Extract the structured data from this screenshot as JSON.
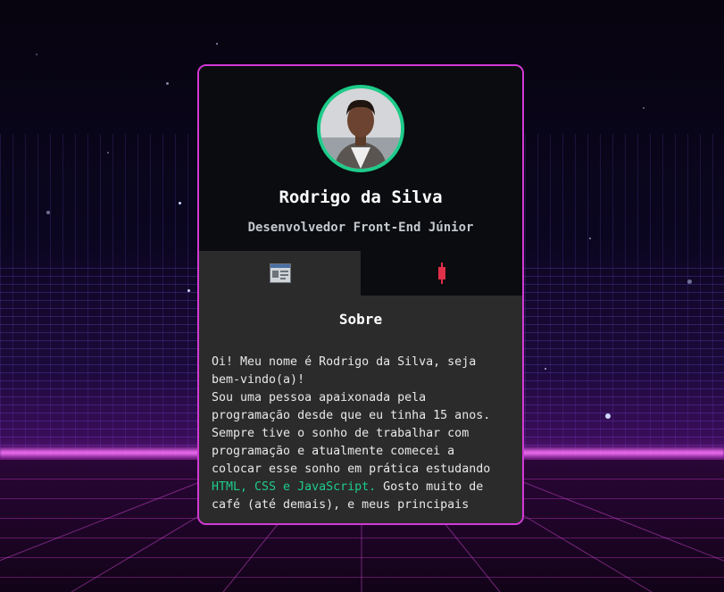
{
  "profile": {
    "name": "Rodrigo da Silva",
    "role": "Desenvolvedor Front-End Júnior",
    "avatar_icon": "avatar-photo"
  },
  "tabs": [
    {
      "icon": "profile-card-icon",
      "active": true
    },
    {
      "icon": "candlestick-icon",
      "active": false
    }
  ],
  "about": {
    "title": "Sobre",
    "line1": "Oi! Meu nome é Rodrigo da Silva, seja bem-vindo(a)!",
    "line2a": "Sou uma pessoa apaixonada pela programação desde que eu tinha 15 anos. Sempre tive o sonho de trabalhar com programação e atualmente comecei a colocar esse sonho em prática estudando ",
    "highlight": "HTML, CSS e JavaScript.",
    "line2b": " Gosto muito de café (até demais), e meus principais"
  },
  "colors": {
    "accent_border": "#d23ad6",
    "avatar_ring": "#1ecb8a",
    "highlight": "#1ecb8a",
    "tab_icon_red": "#e0304a"
  }
}
